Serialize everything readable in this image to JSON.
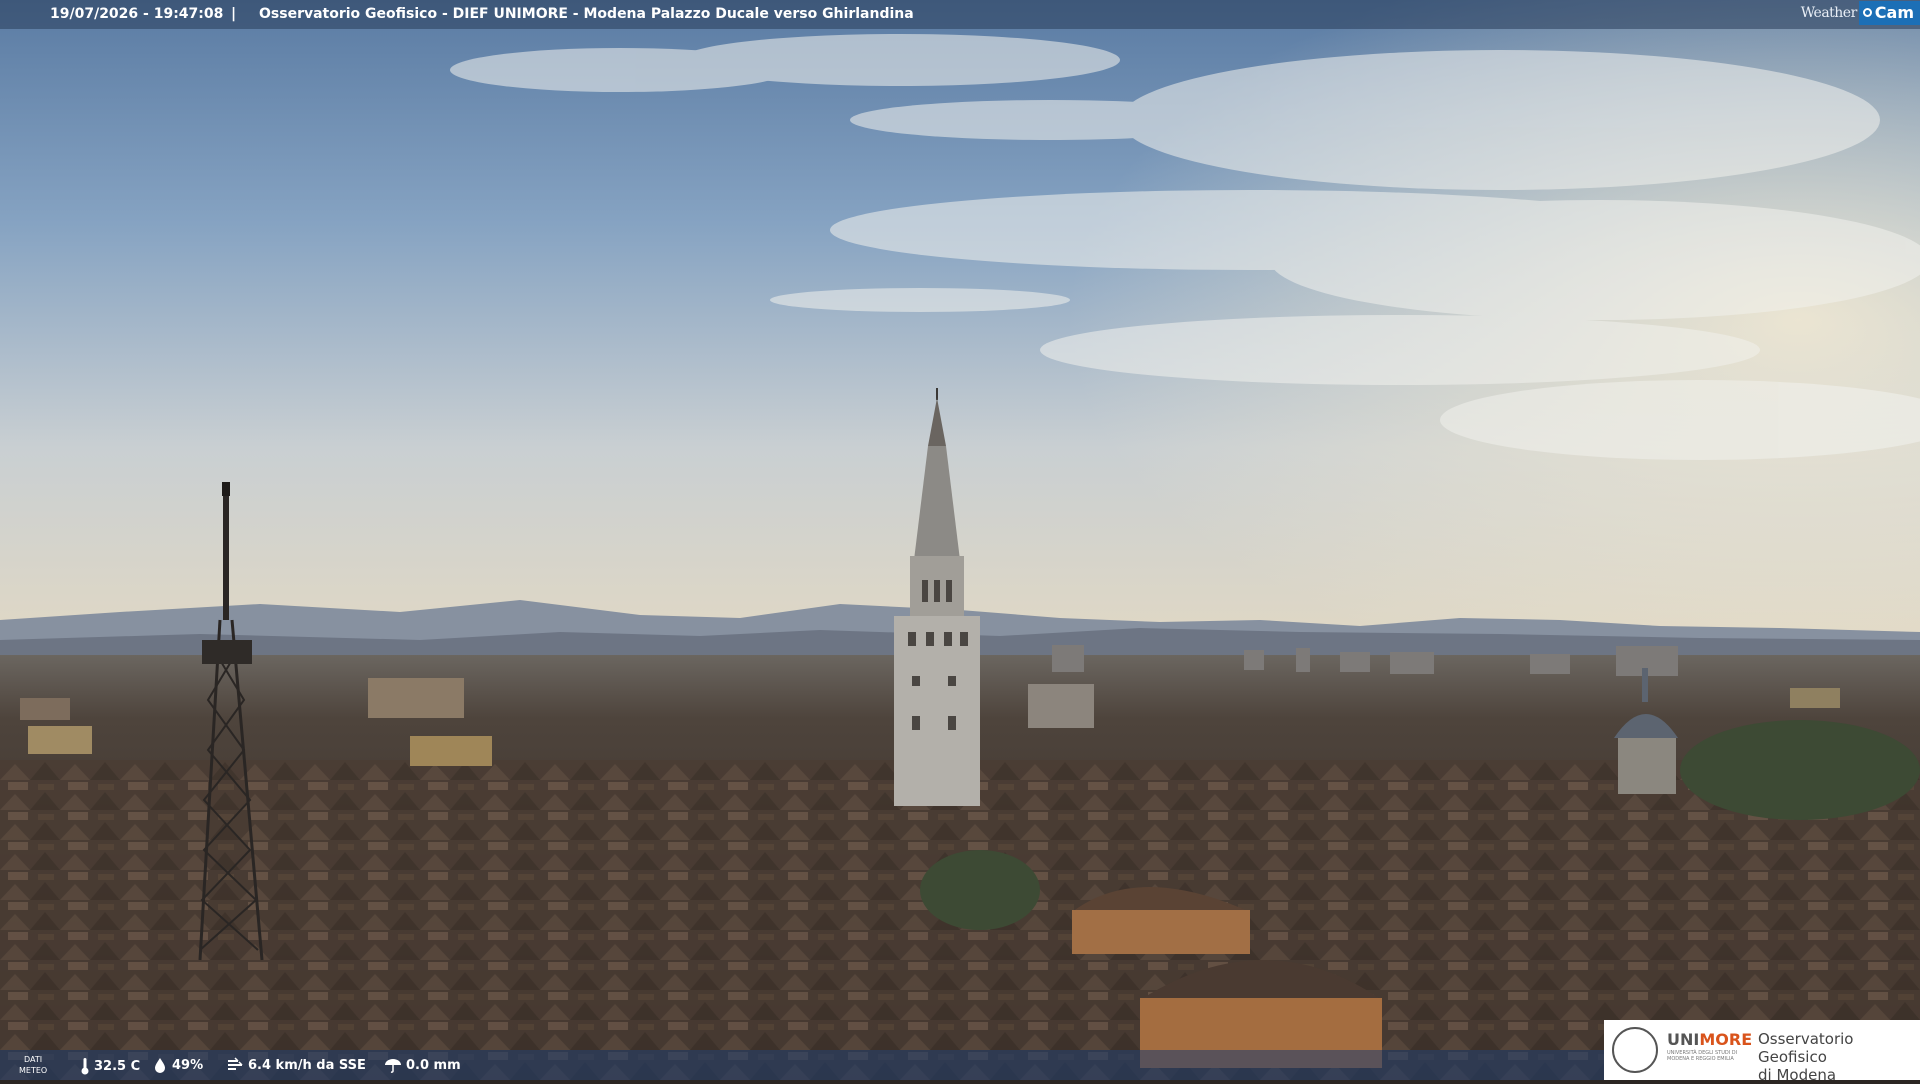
{
  "overlay": {
    "datetime": "19/07/2026 - 19:47:08",
    "separator": "|",
    "title": "Osservatorio Geofisico - DIEF UNIMORE - Modena Palazzo Ducale verso Ghirlandina",
    "brand_weather": "Weather",
    "brand_cam": "Cam"
  },
  "meteo": {
    "label_line1": "DATI",
    "label_line2": "METEO",
    "temperature": "32.5 C",
    "humidity": "49%",
    "wind": "6.4 km/h da SSE",
    "rain": "0.0 mm",
    "icons": [
      "thermometer-icon",
      "humidity-drop-icon",
      "wind-icon",
      "rain-umbrella-icon"
    ]
  },
  "logo": {
    "uni_a": "UNI",
    "uni_b": "MORE",
    "university_full": "UNIVERSITÀ DEGLI STUDI DI MODENA E REGGIO EMILIA",
    "observatory_line1": "Osservatorio Geofisico",
    "observatory_line2": "di Modena"
  },
  "colors": {
    "sky_top": "#5d7fa8",
    "sky_horizon": "#e3dccb",
    "roofs": "#4a3a30",
    "brand_blue": "#1c6fb6",
    "unimore_orange": "#d9541c"
  }
}
